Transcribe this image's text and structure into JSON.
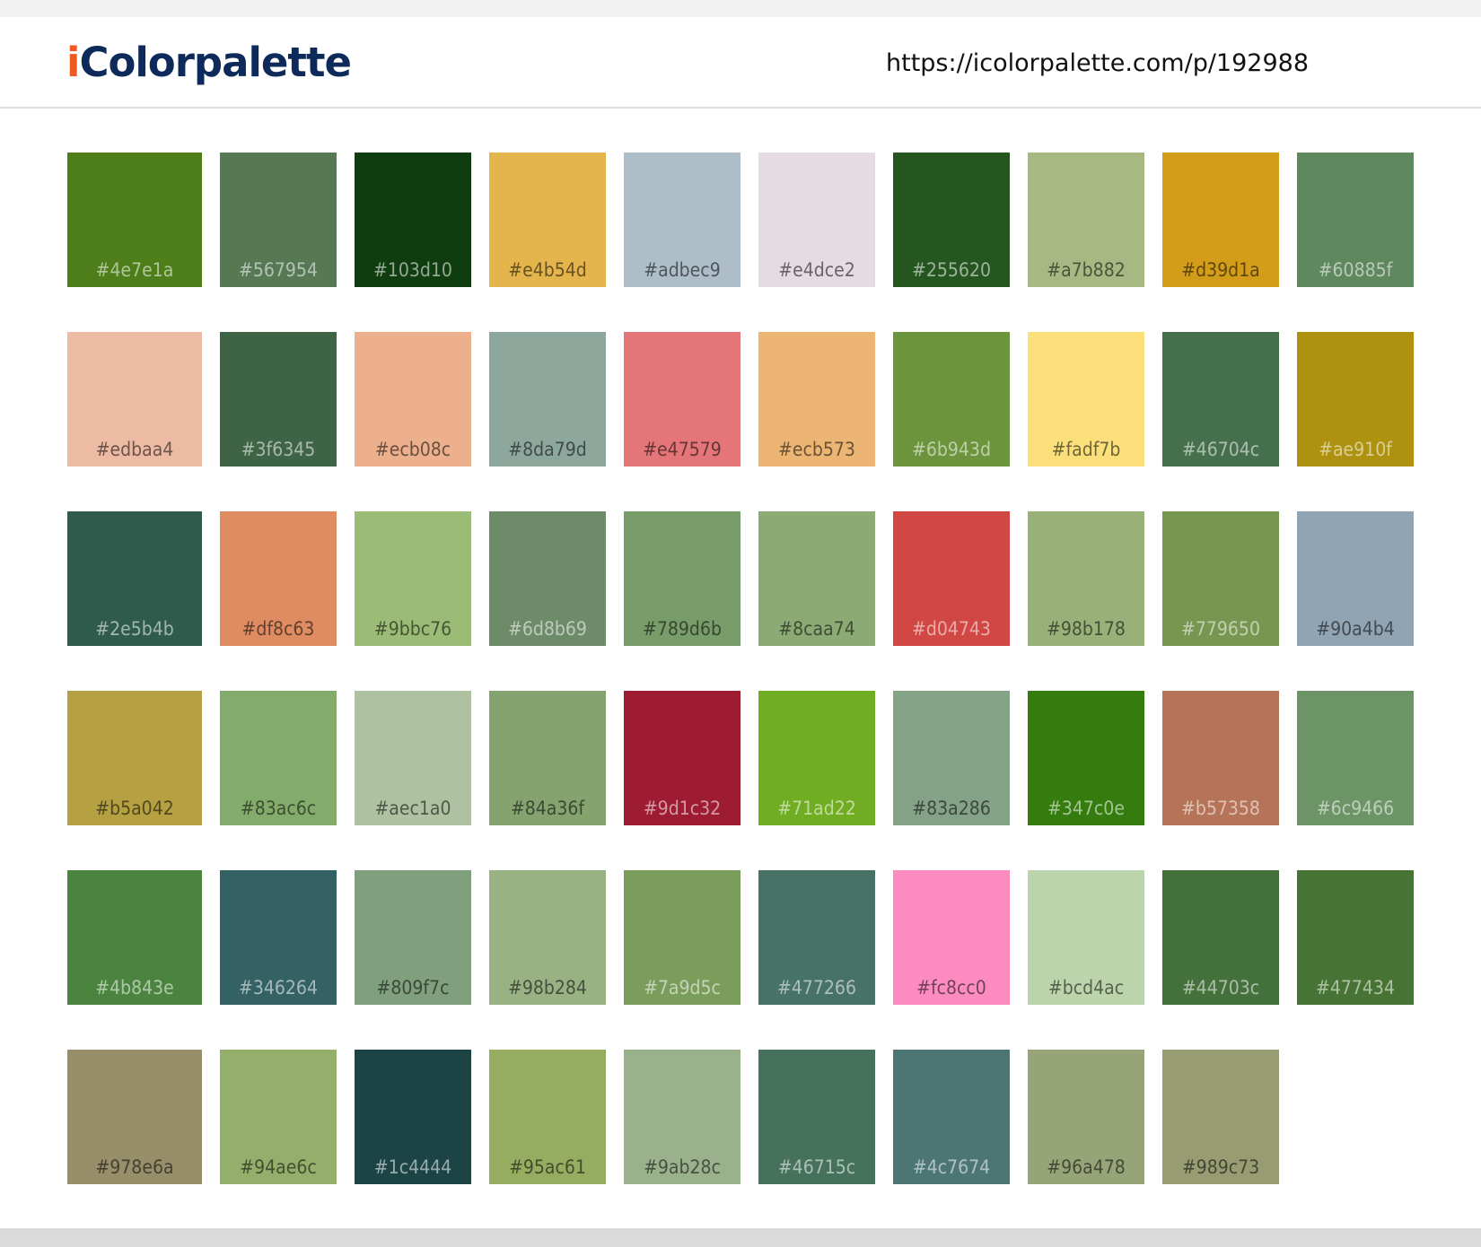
{
  "header": {
    "logo_accent": "i",
    "logo_main": "Colorpalette",
    "url": "https://icolorpalette.com/p/192988"
  },
  "swatches": [
    [
      "#4e7e1a",
      "#567954",
      "#103d10",
      "#e4b54d",
      "#adbec9",
      "#e4dce2",
      "#255620",
      "#a7b882",
      "#d39d1a",
      "#60885f"
    ],
    [
      "#edbaa4",
      "#3f6345",
      "#ecb08c",
      "#8da79d",
      "#e47579",
      "#ecb573",
      "#6b943d",
      "#fadf7b",
      "#46704c",
      "#ae910f"
    ],
    [
      "#2e5b4b",
      "#df8c63",
      "#9bbc76",
      "#6d8b69",
      "#789d6b",
      "#8caa74",
      "#d04743",
      "#98b178",
      "#779650",
      "#90a4b4"
    ],
    [
      "#b5a042",
      "#83ac6c",
      "#aec1a0",
      "#84a36f",
      "#9d1c32",
      "#71ad22",
      "#83a286",
      "#347c0e",
      "#b57358",
      "#6c9466"
    ],
    [
      "#4b843e",
      "#346264",
      "#809f7c",
      "#98b284",
      "#7a9d5c",
      "#477266",
      "#fc8cc0",
      "#bcd4ac",
      "#44703c",
      "#477434"
    ],
    [
      "#978e6a",
      "#94ae6c",
      "#1c4444",
      "#95ac61",
      "#9ab28c",
      "#46715c",
      "#4c7674",
      "#96a478",
      "#989c73"
    ]
  ]
}
